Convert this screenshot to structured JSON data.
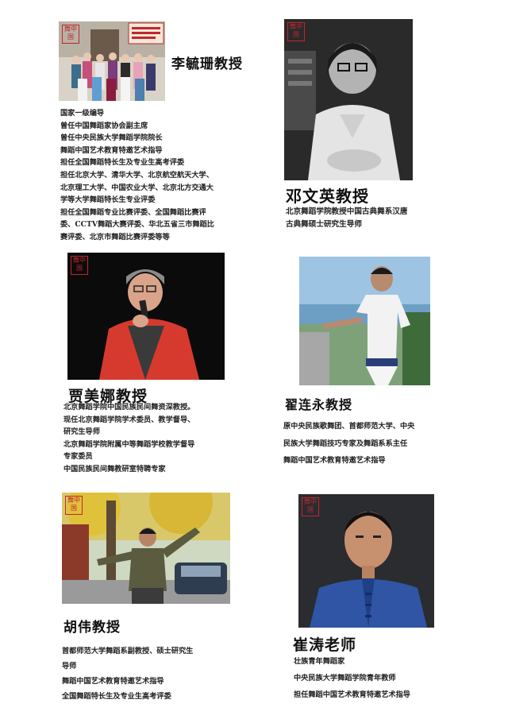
{
  "stamp_text": "舞中国",
  "people": [
    {
      "name": "李毓珊教授",
      "bio": [
        "国家一级编导",
        "曾任中国舞蹈家协会副主席",
        "曾任中央民族大学舞蹈学院院长",
        "舞蹈中国艺术教育特邀艺术指导",
        "担任全国舞蹈特长生及专业生高考评委",
        "担任北京大学、清华大学、北京航空航天大学、",
        "北京理工大学、中国农业大学、北京北方交通大",
        "学等大学舞蹈特长生专业评委",
        "担任全国舞蹈专业比赛评委、全国舞蹈比赛评",
        "委、CCTV舞蹈大赛评委、华北五省三市舞蹈比",
        "赛评委、北京市舞蹈比赛评委等等"
      ]
    },
    {
      "name": "邓文英教授",
      "bio": [
        "北京舞蹈学院教授中国古典舞系汉唐",
        "古典舞硕士研究生导师"
      ]
    },
    {
      "name": "贾美娜教授",
      "bio": [
        "北京舞蹈学院中国民族民间舞资深教授。",
        "现任北京舞蹈学院学术委员、教学督导、",
        "研究生导师",
        "北京舞蹈学院附属中等舞蹈学校教学督导",
        "专家委员",
        "中国民族民间舞教研室特聘专家"
      ]
    },
    {
      "name": "翟连永教授",
      "bio": [
        "原中央民族歌舞团、首都师范大学、中央",
        "民族大学舞蹈技巧专家及舞蹈系系主任",
        "舞蹈中国艺术教育特邀艺术指导"
      ]
    },
    {
      "name": "胡伟教授",
      "bio": [
        "首都师范大学舞蹈系副教授、硕士研究生",
        "导师",
        "舞蹈中国艺术教育特邀艺术指导",
        "全国舞蹈特长生及专业生高考评委"
      ]
    },
    {
      "name": "崔涛老师",
      "bio": [
        "壮族青年舞蹈家",
        "中央民族大学舞蹈学院青年教师",
        "担任舞蹈中国艺术教育特邀艺术指导"
      ]
    }
  ],
  "colors": {
    "stamp_red": "#c0272d",
    "text": "#111111"
  }
}
